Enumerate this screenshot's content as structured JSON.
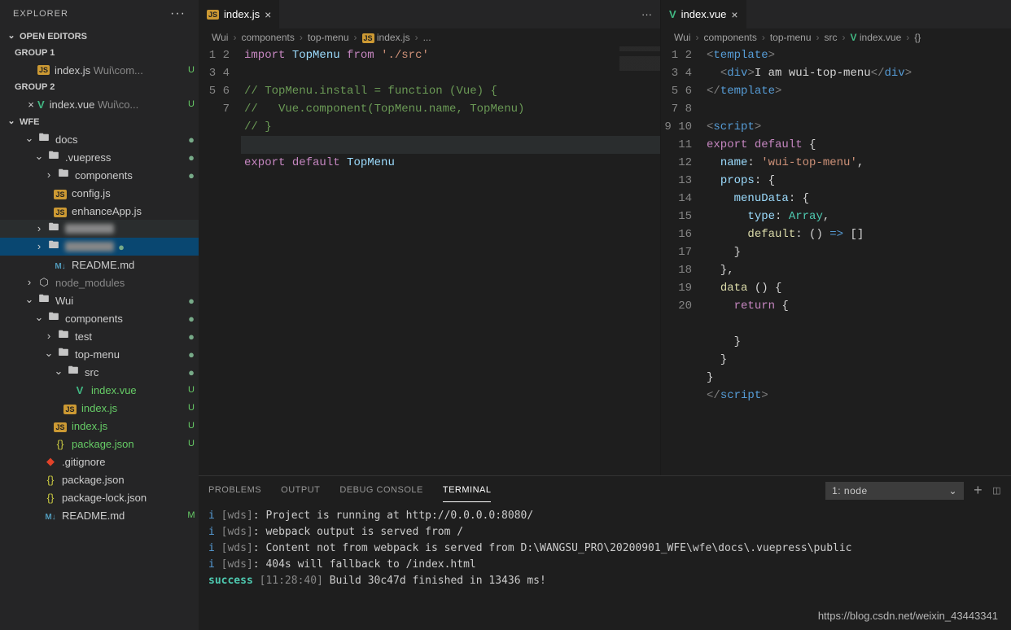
{
  "explorer": {
    "title": "EXPLORER"
  },
  "openEditors": {
    "title": "OPEN EDITORS",
    "groups": [
      {
        "label": "GROUP 1",
        "items": [
          {
            "icon": "js",
            "name": "index.js",
            "path": "Wui\\com...",
            "status": "U"
          }
        ]
      },
      {
        "label": "GROUP 2",
        "items": [
          {
            "icon": "vue",
            "name": "index.vue",
            "path": "Wui\\co...",
            "status": "U",
            "close": true
          }
        ]
      }
    ]
  },
  "workspace": {
    "title": "WFE",
    "tree": [
      {
        "t": "folder",
        "name": "docs",
        "open": true,
        "ind": 1,
        "dot": true
      },
      {
        "t": "folder",
        "name": ".vuepress",
        "open": true,
        "ind": 2,
        "dot": true
      },
      {
        "t": "folder",
        "name": "components",
        "open": false,
        "ind": 3,
        "dot": true
      },
      {
        "t": "file",
        "icon": "js",
        "name": "config.js",
        "ind": 3
      },
      {
        "t": "file",
        "icon": "js",
        "name": "enhanceApp.js",
        "ind": 3
      },
      {
        "t": "folder",
        "name": "",
        "open": false,
        "ind": 2,
        "blur": true,
        "hover": true
      },
      {
        "t": "folder",
        "name": "",
        "open": false,
        "ind": 2,
        "blur": true,
        "selected": true,
        "dot": true
      },
      {
        "t": "file",
        "icon": "md",
        "name": "README.md",
        "ind": 3
      },
      {
        "t": "folder",
        "icon": "node",
        "name": "node_modules",
        "open": false,
        "ind": 1,
        "dim": true
      },
      {
        "t": "folder",
        "name": "Wui",
        "open": true,
        "ind": 1,
        "dot": true
      },
      {
        "t": "folder",
        "name": "components",
        "open": true,
        "ind": 2,
        "dot": true
      },
      {
        "t": "folder",
        "name": "test",
        "open": false,
        "ind": 3,
        "dot": true
      },
      {
        "t": "folder",
        "name": "top-menu",
        "open": true,
        "ind": 3,
        "dot": true
      },
      {
        "t": "folder",
        "name": "src",
        "open": true,
        "ind": 4,
        "dot": true
      },
      {
        "t": "file",
        "icon": "vue",
        "name": "index.vue",
        "ind": 5,
        "status": "U",
        "green": true
      },
      {
        "t": "file",
        "icon": "js",
        "name": "index.js",
        "ind": 4,
        "status": "U",
        "green": true
      },
      {
        "t": "file",
        "icon": "js",
        "name": "index.js",
        "ind": 3,
        "status": "U",
        "green": true
      },
      {
        "t": "file",
        "icon": "json",
        "name": "package.json",
        "ind": 3,
        "status": "U",
        "green": true
      },
      {
        "t": "file",
        "icon": "git",
        "name": ".gitignore",
        "ind": 2
      },
      {
        "t": "file",
        "icon": "json",
        "name": "package.json",
        "ind": 2
      },
      {
        "t": "file",
        "icon": "json",
        "name": "package-lock.json",
        "ind": 2
      },
      {
        "t": "file",
        "icon": "md",
        "name": "README.md",
        "ind": 2,
        "status": "M"
      }
    ]
  },
  "editorLeft": {
    "tab": {
      "icon": "js",
      "name": "index.js"
    },
    "breadcrumb": [
      "Wui",
      "components",
      "top-menu",
      "index.js",
      "..."
    ],
    "lines": 7
  },
  "editorRight": {
    "tab": {
      "icon": "vue",
      "name": "index.vue"
    },
    "breadcrumb": [
      "Wui",
      "components",
      "top-menu",
      "src",
      "index.vue",
      "{}"
    ],
    "lines": 20
  },
  "panel": {
    "tabs": [
      "PROBLEMS",
      "OUTPUT",
      "DEBUG CONSOLE",
      "TERMINAL"
    ],
    "activeTab": 3,
    "select": "1: node",
    "terminal": [
      {
        "prefix": "i",
        "tag": "[wds]",
        "text": ": Project is running at http://0.0.0.0:8080/"
      },
      {
        "prefix": "i",
        "tag": "[wds]",
        "text": ": webpack output is served from /"
      },
      {
        "prefix": "i",
        "tag": "[wds]",
        "text": ": Content not from webpack is served from D:\\WANGSU_PRO\\20200901_WFE\\wfe\\docs\\.vuepress\\public"
      },
      {
        "prefix": "i",
        "tag": "[wds]",
        "text": ": 404s will fallback to /index.html"
      },
      {
        "prefix": "success",
        "tag": "[11:28:40]",
        "text": " Build 30c47d finished in 13436 ms!"
      }
    ]
  },
  "watermark": "https://blog.csdn.net/weixin_43443341"
}
